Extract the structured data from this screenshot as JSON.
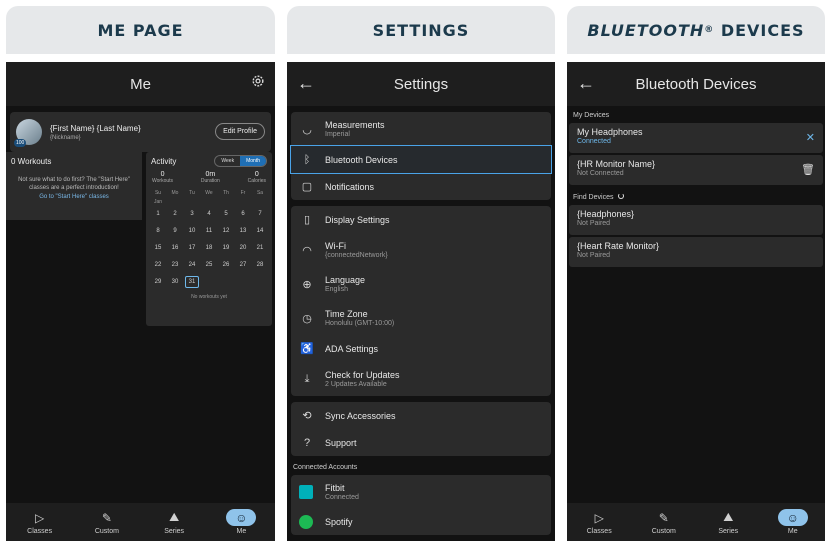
{
  "headers": {
    "me": "ME PAGE",
    "settings": "SETTINGS",
    "bt_main": "BLUETOOTH",
    "bt_reg": "®",
    "bt_suffix": " DEVICES"
  },
  "me": {
    "title": "Me",
    "profile": {
      "name": "{First Name} {Last Name}",
      "nickname": "{Nickname}",
      "badge": "100",
      "edit_label": "Edit Profile"
    },
    "workouts": {
      "title": "0 Workouts",
      "message": "Not sure what to do first? The \"Start Here\" classes are a perfect introduction!",
      "link": "Go to \"Start Here\" classes"
    },
    "activity": {
      "title": "Activity",
      "week_label": "Week",
      "month_label": "Month",
      "stats": [
        {
          "value": "0",
          "label": "Workouts"
        },
        {
          "value": "0m",
          "label": "Duration"
        },
        {
          "value": "0",
          "label": "Calories"
        }
      ],
      "days": [
        "Su",
        "Mo",
        "Tu",
        "We",
        "Th",
        "Fr",
        "Sa"
      ],
      "month": "Jan",
      "weeks": [
        [
          "1",
          "2",
          "3",
          "4",
          "5",
          "6",
          "7"
        ],
        [
          "8",
          "9",
          "10",
          "11",
          "12",
          "13",
          "14"
        ],
        [
          "15",
          "16",
          "17",
          "18",
          "19",
          "20",
          "21"
        ],
        [
          "22",
          "23",
          "24",
          "25",
          "26",
          "27",
          "28"
        ],
        [
          "29",
          "30",
          "31",
          "",
          "",
          "",
          ""
        ]
      ],
      "today": "31",
      "empty": "No workouts yet"
    }
  },
  "settings": {
    "title": "Settings",
    "group1": [
      {
        "label": "Measurements",
        "sub": "Imperial",
        "icon": "◡"
      },
      {
        "label": "Bluetooth Devices",
        "sub": "",
        "icon": "ᛒ"
      },
      {
        "label": "Notifications",
        "sub": "",
        "icon": "▢"
      }
    ],
    "group2": [
      {
        "label": "Display Settings",
        "sub": "",
        "icon": "▯"
      },
      {
        "label": "Wi-Fi",
        "sub": "{connectedNetwork}",
        "icon": "◠"
      },
      {
        "label": "Language",
        "sub": "English",
        "icon": "⊕"
      },
      {
        "label": "Time Zone",
        "sub": "Honolulu (GMT-10:00)",
        "icon": "◷"
      },
      {
        "label": "ADA Settings",
        "sub": "",
        "icon": "♿"
      },
      {
        "label": "Check for Updates",
        "sub": "2 Updates Available",
        "icon": "⤓"
      }
    ],
    "group3": [
      {
        "label": "Sync Accessories",
        "sub": "",
        "icon": "⟲"
      },
      {
        "label": "Support",
        "sub": "",
        "icon": "?"
      }
    ],
    "connected_label": "Connected Accounts",
    "accounts": [
      {
        "label": "Fitbit",
        "sub": "Connected",
        "color": "#00b0b9"
      },
      {
        "label": "Spotify",
        "sub": "",
        "color": "#1db954"
      }
    ]
  },
  "bluetooth": {
    "title": "Bluetooth Devices",
    "my_devices_label": "My Devices",
    "my_devices": [
      {
        "name": "My Headphones",
        "status": "Connected",
        "status_color": "#6fb8ea",
        "action": "✕"
      },
      {
        "name": "{HR Monitor Name}",
        "status": "Not Connected",
        "status_color": "#9a9a9a",
        "action": "🗑"
      }
    ],
    "find_label": "Find Devices",
    "found": [
      {
        "name": "{Headphones}",
        "status": "Not Paired"
      },
      {
        "name": "{Heart Rate Monitor}",
        "status": "Not Paired"
      }
    ]
  },
  "nav": [
    {
      "label": "Classes",
      "icon": "▷"
    },
    {
      "label": "Custom",
      "icon": "✎"
    },
    {
      "label": "Series",
      "icon": "⛰"
    },
    {
      "label": "Me",
      "icon": "☺"
    }
  ]
}
